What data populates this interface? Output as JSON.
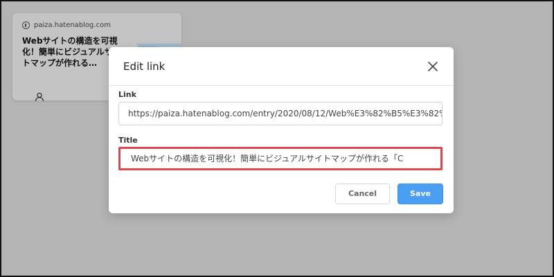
{
  "background_card": {
    "domain": "paiza.hatenablog.com",
    "title": "Webサイトの構造を可視化！簡単にビジュアルサイトマップが作れる…",
    "domain_icon": "info-circle-icon",
    "user_icon": "person-icon"
  },
  "modal": {
    "title": "Edit link",
    "close_icon": "close-icon",
    "link": {
      "label": "Link",
      "value": "https://paiza.hatenablog.com/entry/2020/08/12/Web%E3%82%B5%E3%82%"
    },
    "title_field": {
      "label": "Title",
      "value": "Webサイトの構造を可視化！簡単にビジュアルサイトマップが作れる「C"
    },
    "buttons": {
      "cancel": "Cancel",
      "save": "Save"
    }
  },
  "colors": {
    "overlay": "#b5b5b5",
    "save_button": "#4b9ff2",
    "highlight_border": "#e0474c"
  }
}
